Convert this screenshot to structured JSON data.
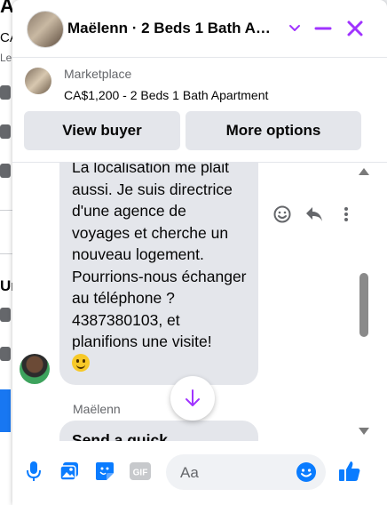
{
  "background": {
    "title_fragment": "A",
    "text_1": "CA",
    "text_2": "Le",
    "text_3": "Ur"
  },
  "header": {
    "title": "Maëlenn · 2 Beds 1 Bath A…",
    "accent": "#a033ff"
  },
  "listing": {
    "label": "Marketplace",
    "title": "CA$1,200 - 2 Beds 1 Bath Apartment",
    "view_buyer_label": "View buyer",
    "more_options_label": "More options"
  },
  "messages": {
    "incoming_text": "La localisation me plait aussi. Je suis directrice d'une agence de voyages et cherche un nouveau logement. Pourrions-nous échanger au téléphone ? 4387380103, et planifions une visite!",
    "sender_name": "Maëlenn",
    "next_message_preview": "Send a quick"
  },
  "composer": {
    "placeholder": "Aa",
    "gif_label": "GIF",
    "brand_color": "#0a7cff"
  }
}
